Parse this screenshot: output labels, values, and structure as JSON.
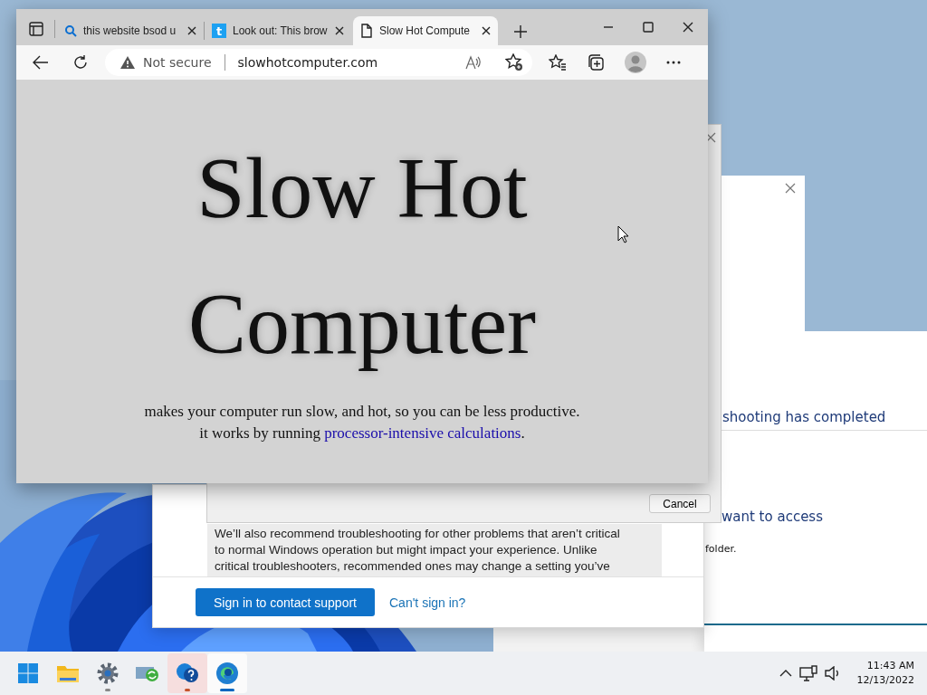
{
  "browser": {
    "tabs": [
      {
        "title": "this website bsod u",
        "selected": false
      },
      {
        "icon_text": "t",
        "title": "Look out: This brow",
        "selected": false
      },
      {
        "title": "Slow Hot Compute",
        "selected": true
      }
    ],
    "address": {
      "security": "Not secure",
      "url": "slowhotcomputer.com"
    },
    "page": {
      "heading": "Slow Hot Computer",
      "line_1": "makes your computer run slow, and hot, so you can be less productive.",
      "line_2_before": "it works by running ",
      "link": "processor-intensive calculations",
      "line_2_after": "."
    }
  },
  "cancel_dialog": {
    "button": "Cancel"
  },
  "notice_1": {
    "text": "shooting has completed"
  },
  "notice_2": {
    "heading": "want to access",
    "text": "folder."
  },
  "troubleshoot_dialog": {
    "paragraph_lines": [
      "We’ll also recommend troubleshooting for other problems that aren’t critical",
      "to normal Windows operation but might impact your experience. Unlike",
      "critical troubleshooters, recommended ones may change a setting you’ve"
    ],
    "primary_button": "Sign in to contact support",
    "link": "Can't sign in?"
  },
  "taskbar": {
    "apps": [
      {
        "running": false,
        "attention": false,
        "selected": false
      },
      {
        "running": false,
        "attention": false,
        "selected": false
      },
      {
        "running": true,
        "attention": false,
        "selected": false
      },
      {
        "running": false,
        "attention": false,
        "selected": false
      },
      {
        "running": true,
        "attention": true,
        "selected": false
      },
      {
        "running": true,
        "attention": false,
        "selected": true
      }
    ],
    "time": "11:43 AM",
    "date": "12/13/2022"
  }
}
